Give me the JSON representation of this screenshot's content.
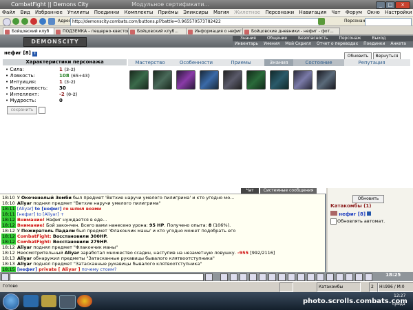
{
  "window": {
    "title": "CombatFight || Demons City",
    "title2": "Модульное сертификати..."
  },
  "menubar": [
    "Файл",
    "Вид",
    "Избранное",
    "Утилиты",
    "Поединки",
    "Комплекты",
    "Приёмы",
    "Эликсиры",
    "Магия",
    "Жилетное",
    "Персонажи",
    "Навигация",
    "Чат",
    "Форум",
    "Окно",
    "Настройки",
    "(?)"
  ],
  "address": {
    "label": "Адрес:",
    "url": "http://demonscity.combats.com/buttons.pl?battle=0.965570573782422",
    "search_label": "Персонаж:"
  },
  "tabs": [
    "Бойцовский клуб",
    "ПОДЗЕМКА – пещерно-квестовый по...",
    "Бойцовский клуб...",
    "Информация о нефиг",
    "Бойцовские дневники - нефиг - фот..."
  ],
  "game": {
    "logo": "DEMONSCITY",
    "nav_top": [
      "Знания",
      "Общение",
      "Безопасность",
      "Персонаж",
      "Выход"
    ],
    "nav_bottom": [
      "Инвентарь",
      "Умения",
      "Мой Скрилл",
      "Отчет о переводах",
      "Поединки",
      "Анкета"
    ]
  },
  "character": {
    "name": "нефиг [8]",
    "badge": "i",
    "buttons": {
      "refresh": "Обновить",
      "back": "Вернуться",
      "save": "сохранить"
    },
    "attributes_title": "Характеристики персонажа",
    "attributes": [
      {
        "label": "Сила:",
        "value": "1",
        "extra": "(3-2)"
      },
      {
        "label": "Ловкость:",
        "value": "108",
        "extra": "(65+43)"
      },
      {
        "label": "Интуиция:",
        "value": "1",
        "extra": "(3-2)"
      },
      {
        "label": "Выносливость:",
        "value": "30",
        "extra": ""
      },
      {
        "label": "Интеллект:",
        "value": "-2",
        "extra": "(0-2)"
      },
      {
        "label": "Мудрость:",
        "value": "0",
        "extra": ""
      }
    ]
  },
  "game_tabs": [
    "Мастерство",
    "Особенности",
    "Приемы",
    "Знания",
    "Состояние",
    "Репутация"
  ],
  "skills": [
    {
      "color": "#3a6a4a"
    },
    {
      "color": "#4a6a5a"
    },
    {
      "color": "#8a3aa8"
    },
    {
      "color": "#3a6aa8"
    },
    {
      "color": "#5a5a6a"
    },
    {
      "color": "#2a6a3a"
    },
    {
      "color": "#2a5a6a"
    },
    {
      "color": "#7a7aa8"
    },
    {
      "color": "#3a4a5a"
    },
    {
      "color": "#5a6a7a"
    }
  ],
  "chat_tabs": {
    "chat": "Чат",
    "system": "Системные сообщения"
  },
  "chat": [
    {
      "time": "18:10",
      "style": "plain",
      "segs": [
        {
          "c": "",
          "t": "У "
        },
        {
          "c": "nick",
          "t": "Окоченелый Зомби"
        },
        {
          "c": "",
          "t": " был предмет 'Ветхие наручи умелого пилигрима' и кто угодно мо..."
        }
      ]
    },
    {
      "time": "18:10",
      "style": "plain",
      "segs": [
        {
          "c": "nick",
          "t": "Aliyar"
        },
        {
          "c": "",
          "t": " поднял предмет \"Ветхие наручи умелого пилигрима\""
        }
      ]
    },
    {
      "time": "18:11",
      "style": "green",
      "segs": [
        {
          "c": "blue",
          "t": "[Aliyar]"
        },
        {
          "c": "",
          "t": " "
        },
        {
          "c": "bluebold",
          "t": "to [нефиг]"
        },
        {
          "c": "",
          "t": " "
        },
        {
          "c": "red",
          "t": "го шпил возми"
        }
      ]
    },
    {
      "time": "18:11",
      "style": "green",
      "segs": [
        {
          "c": "blue",
          "t": "[нефиг] to [Aliyar] +"
        }
      ]
    },
    {
      "time": "18:12",
      "style": "green",
      "segs": [
        {
          "c": "red",
          "t": "Внимание!"
        },
        {
          "c": "",
          "t": " Нафиг нуждается в еде..."
        }
      ]
    },
    {
      "time": "18:12",
      "style": "green",
      "segs": [
        {
          "c": "red",
          "t": "Внимание!"
        },
        {
          "c": "",
          "t": " Бой закончен. Всего вами нанесено урона: "
        },
        {
          "c": "nick",
          "t": "95 HP"
        },
        {
          "c": "",
          "t": ". Получено опыта: "
        },
        {
          "c": "nick",
          "t": "8"
        },
        {
          "c": "",
          "t": " (106%)."
        }
      ]
    },
    {
      "time": "18:12",
      "style": "plain",
      "segs": [
        {
          "c": "",
          "t": "У "
        },
        {
          "c": "nick",
          "t": "Пожиратель Падали"
        },
        {
          "c": "",
          "t": " был предмет 'Флакончик маны' и кто угодно может подобрать его"
        }
      ]
    },
    {
      "time": "18:12",
      "style": "green",
      "segs": [
        {
          "c": "red",
          "t": "CombatFight:"
        },
        {
          "c": "nick",
          "t": " Восстановили 300HP."
        }
      ]
    },
    {
      "time": "18:12",
      "style": "green",
      "segs": [
        {
          "c": "red",
          "t": "CombatFight:"
        },
        {
          "c": "nick",
          "t": " Восстановили 279HP."
        }
      ]
    },
    {
      "time": "18:12",
      "style": "plain",
      "segs": [
        {
          "c": "nick",
          "t": "Aliyar"
        },
        {
          "c": "",
          "t": " поднял предмет \"Флакончик маны\""
        }
      ]
    },
    {
      "time": "18:12",
      "style": "plain",
      "segs": [
        {
          "c": "",
          "t": "Неосмотрительный "
        },
        {
          "c": "nick",
          "t": "Aliyar"
        },
        {
          "c": "",
          "t": " заработал множество ссадин, наступив на незаметную ловушку. "
        },
        {
          "c": "red",
          "t": "-955"
        },
        {
          "c": "",
          "t": " [992/2116]"
        }
      ]
    },
    {
      "time": "18:13",
      "style": "plain",
      "segs": [
        {
          "c": "nick",
          "t": "Aliyar"
        },
        {
          "c": "",
          "t": " обнаружил предметы \"Затасканные рукавицы бывалого клятвоотступника\""
        }
      ]
    },
    {
      "time": "18:13",
      "style": "plain",
      "segs": [
        {
          "c": "nick",
          "t": "Aliyar"
        },
        {
          "c": "",
          "t": " поднял предмет \"Затасканные рукавицы бывалого клятвоотступника\""
        }
      ]
    },
    {
      "time": "18:15",
      "style": "green",
      "segs": [
        {
          "c": "bluebold",
          "t": "[нефиг]"
        },
        {
          "c": "",
          "t": " "
        },
        {
          "c": "red",
          "t": "private [ Aliyar ]"
        },
        {
          "c": "",
          "t": " "
        },
        {
          "c": "blue",
          "t": "почему стоим?"
        }
      ]
    }
  ],
  "right_panel": {
    "refresh": "Обновить",
    "location": "Катакомбы (1)",
    "user": "нефиг [8]",
    "auto": "Обновлять автомат."
  },
  "chatbar": {
    "clock": "18:25"
  },
  "statusbar": {
    "status": "Готово",
    "location": "Катакомбы",
    "counter": "2",
    "hp": "HI:996 / M:0"
  },
  "taskbar": {
    "watermark": "photo.scrolls.combats.com",
    "time": "12:27",
    "day": "среда"
  }
}
